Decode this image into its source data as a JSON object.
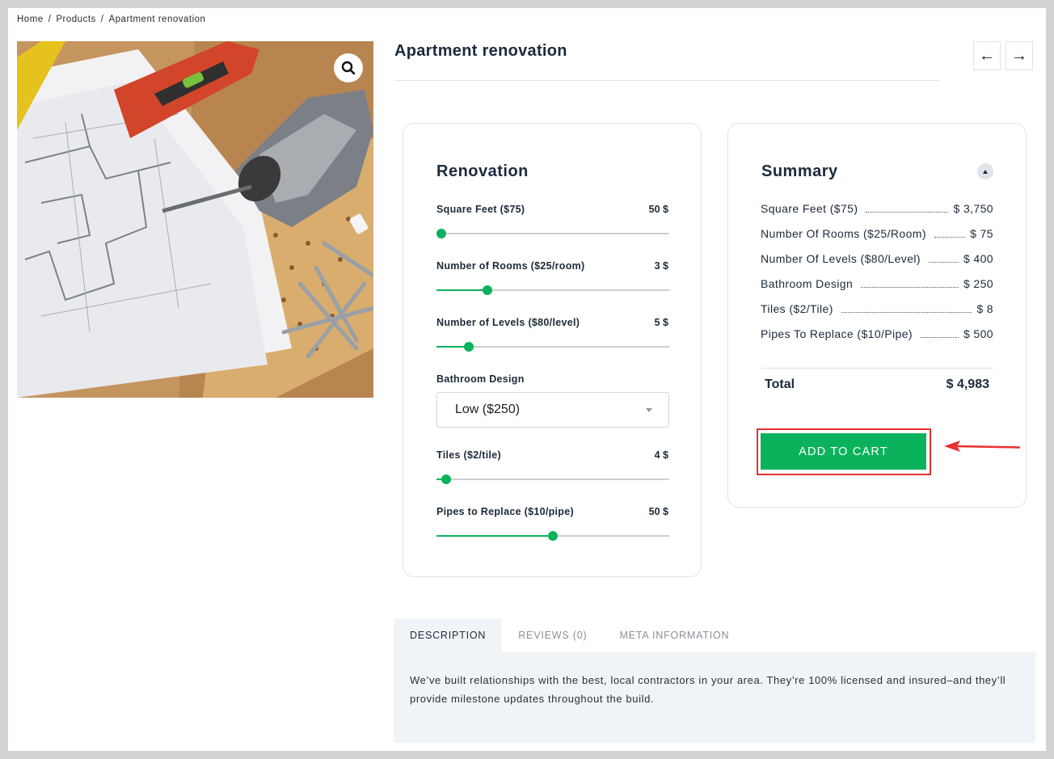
{
  "breadcrumb": {
    "home": "Home",
    "sep": "/",
    "products": "Products",
    "current": "Apartment renovation"
  },
  "product": {
    "title": "Apartment renovation",
    "prev_icon": "←",
    "next_icon": "→"
  },
  "calculator": {
    "title": "Renovation",
    "sliders": [
      {
        "label": "Square Feet ($75)",
        "value": "50 $",
        "fraction": 0.02
      },
      {
        "label": "Number of Rooms ($25/room)",
        "value": "3 $",
        "fraction": 0.22
      },
      {
        "label": "Number of Levels ($80/level)",
        "value": "5 $",
        "fraction": 0.14
      },
      {
        "label": "Tiles ($2/tile)",
        "value": "4 $",
        "fraction": 0.04
      },
      {
        "label": "Pipes to Replace ($10/pipe)",
        "value": "50 $",
        "fraction": 0.5
      }
    ],
    "bathroom": {
      "label": "Bathroom Design",
      "selected": "Low ($250)"
    }
  },
  "summary": {
    "title": "Summary",
    "rows": [
      {
        "label": "Square Feet ($75)",
        "value": "$ 3,750"
      },
      {
        "label": "Number Of Rooms ($25/Room)",
        "value": "$ 75"
      },
      {
        "label": "Number Of Levels ($80/Level)",
        "value": "$ 400"
      },
      {
        "label": "Bathroom Design",
        "value": "$ 250"
      },
      {
        "label": "Tiles ($2/Tile)",
        "value": "$ 8"
      },
      {
        "label": "Pipes To Replace ($10/Pipe)",
        "value": "$ 500"
      }
    ],
    "total_label": "Total",
    "total_value": "$ 4,983",
    "add_to_cart": "ADD TO CART"
  },
  "tabs": {
    "description": "DESCRIPTION",
    "reviews": "REVIEWS (0)",
    "meta": "META INFORMATION",
    "description_text": "We’ve built relationships with the best, local contractors in your area. They’re 100% licensed and insured–and they’ll provide milestone updates throughout the build."
  },
  "colors": {
    "accent": "#0ab25c",
    "annotation": "#ea2f2f",
    "text": "#1c2a3a"
  }
}
